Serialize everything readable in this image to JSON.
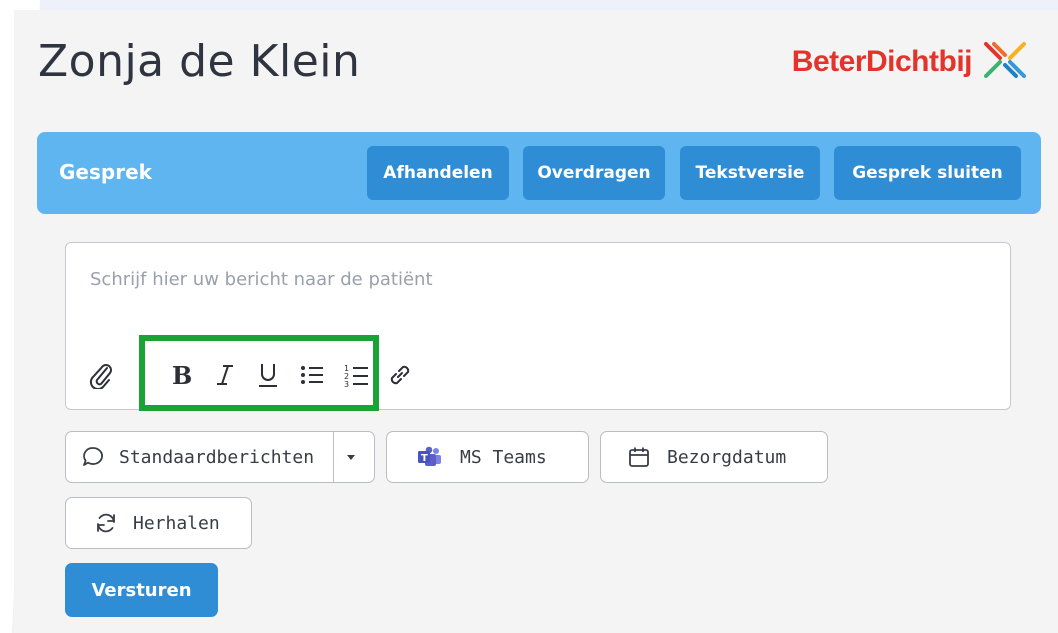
{
  "page": {
    "patient_name": "Zonja de Klein"
  },
  "logo": {
    "text": "BeterDichtbij",
    "icon": "x-cross-logo-icon"
  },
  "header": {
    "title": "Gesprek",
    "buttons": [
      "Afhandelen",
      "Overdragen",
      "Tekstversie",
      "Gesprek sluiten"
    ]
  },
  "editor": {
    "placeholder": "Schrijf hier uw bericht naar de patiënt",
    "toolbar": [
      "paperclip-icon",
      "bold-icon",
      "italic-icon",
      "underline-icon",
      "bullet-list-icon",
      "numbered-list-icon",
      "link-icon"
    ]
  },
  "actions": {
    "standard_messages": "Standaardberichten",
    "ms_teams": "MS Teams",
    "delivery_date": "Bezorgdatum",
    "repeat": "Herhalen",
    "send": "Versturen"
  },
  "colors": {
    "brand_red": "#e2342b",
    "header_blue": "#5eb5ef",
    "button_blue": "#2f8dd6",
    "highlight_green": "#19a335",
    "teams_purple": "#5b5fc7"
  }
}
